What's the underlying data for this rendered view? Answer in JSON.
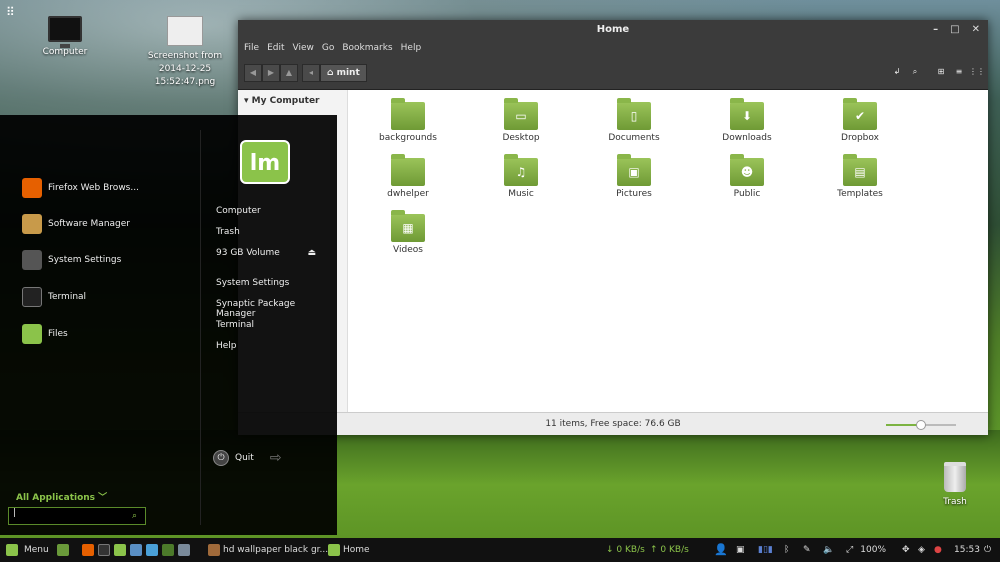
{
  "desktop": {
    "icons": [
      {
        "label": "Computer"
      },
      {
        "label": "Screenshot from 2014-12-25 15:52:47.png"
      },
      {
        "label": "Trash"
      }
    ]
  },
  "file_manager": {
    "title": "Home",
    "menubar": [
      "File",
      "Edit",
      "View",
      "Go",
      "Bookmarks",
      "Help"
    ],
    "breadcrumb": "mint",
    "sidebar_heading": "My Computer",
    "folders": [
      {
        "label": "backgrounds",
        "icon": "folder-icon"
      },
      {
        "label": "Desktop",
        "icon": "desktop-folder-icon"
      },
      {
        "label": "Documents",
        "icon": "documents-folder-icon"
      },
      {
        "label": "Downloads",
        "icon": "downloads-folder-icon"
      },
      {
        "label": "Dropbox",
        "icon": "dropbox-folder-icon"
      },
      {
        "label": "dwhelper",
        "icon": "folder-icon"
      },
      {
        "label": "Music",
        "icon": "music-folder-icon"
      },
      {
        "label": "Pictures",
        "icon": "pictures-folder-icon"
      },
      {
        "label": "Public",
        "icon": "public-folder-icon"
      },
      {
        "label": "Templates",
        "icon": "templates-folder-icon"
      },
      {
        "label": "Videos",
        "icon": "videos-folder-icon"
      }
    ],
    "status": "11 items, Free space: 76.6 GB",
    "zoom_level": 0.5
  },
  "mint_menu": {
    "favorites": [
      {
        "label": "Firefox Web Brows...",
        "color": "#e66000"
      },
      {
        "label": "Software Manager",
        "color": "#c89a4a"
      },
      {
        "label": "System Settings",
        "color": "#555555"
      },
      {
        "label": "Terminal",
        "color": "#222222"
      },
      {
        "label": "Files",
        "color": "#8bc34a"
      }
    ],
    "places": [
      "Computer",
      "Trash",
      "93 GB Volume"
    ],
    "system": [
      "System Settings",
      "Synaptic Package Manager",
      "Terminal",
      "Help"
    ],
    "quit_label": "Quit",
    "all_applications": "All Applications",
    "search_value": "|"
  },
  "taskbar": {
    "menu_label": "Menu",
    "windows": [
      {
        "label": "hd wallpaper black gr..."
      },
      {
        "label": "Home"
      }
    ],
    "net_down": "↓ 0 KB/s",
    "net_up": "↑ 0 KB/s",
    "battery": "100%",
    "clock": "15:53",
    "accent": "#8bc34a"
  }
}
